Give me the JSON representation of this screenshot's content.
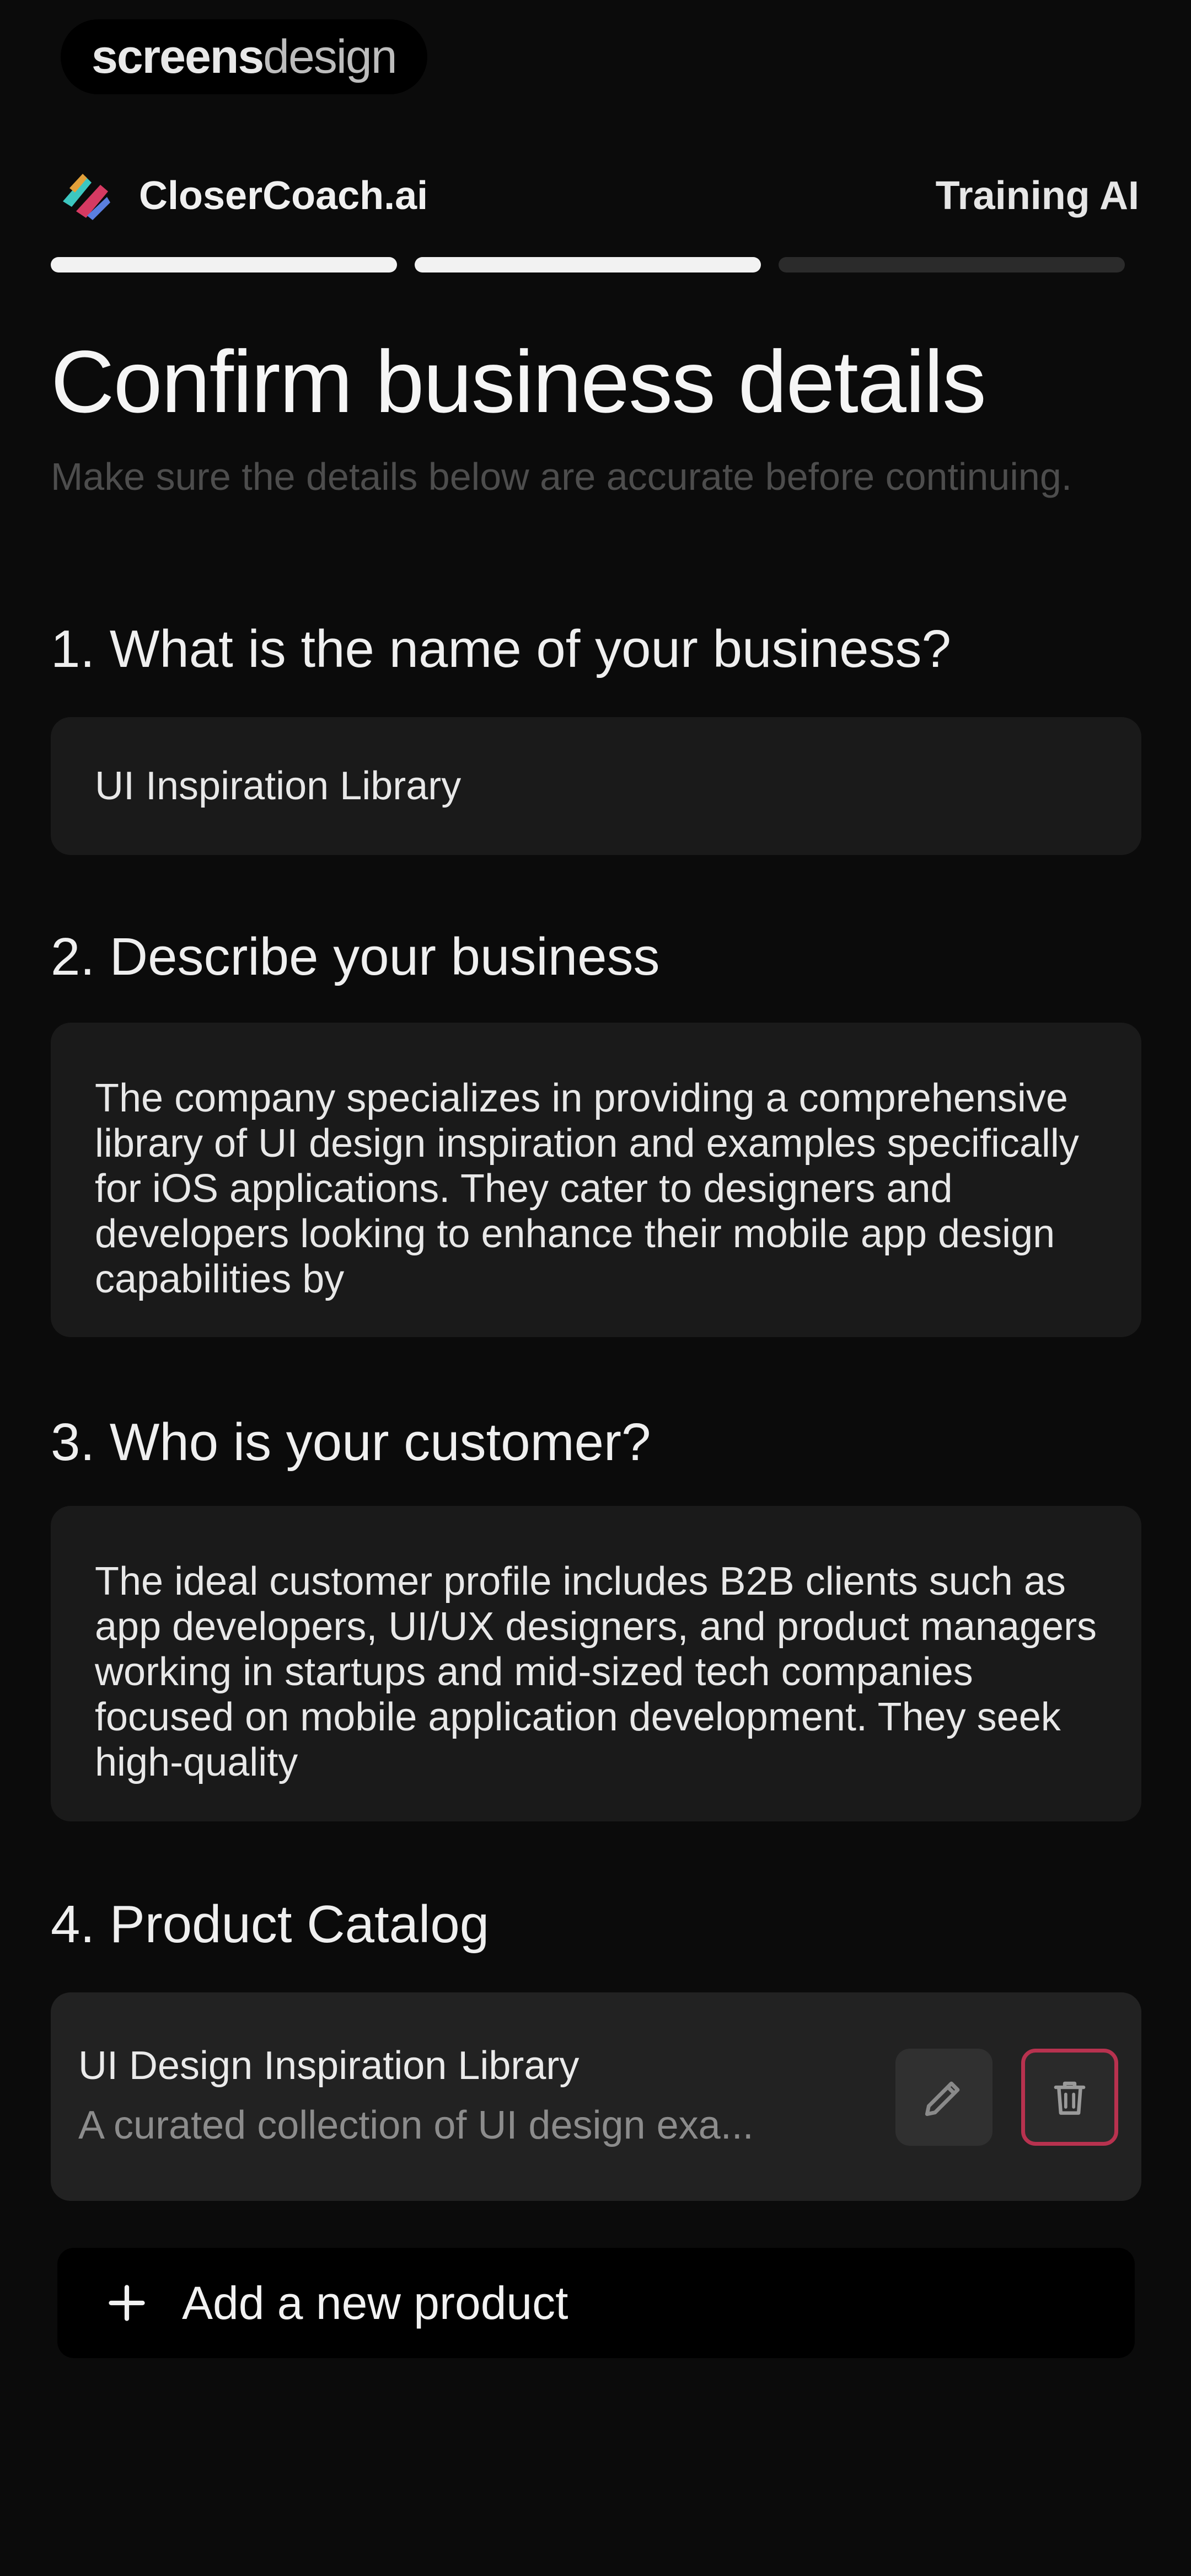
{
  "watermark": {
    "bold": "screens",
    "light": "design"
  },
  "header": {
    "brand": "CloserCoach.ai",
    "right_label": "Training AI",
    "progress": {
      "total_steps": 3,
      "completed_steps": 2
    }
  },
  "page": {
    "title": "Confirm business details",
    "subtitle": "Make sure the details below are accurate before continuing."
  },
  "questions": [
    {
      "label": "1. What is the name of your business?",
      "value": "UI Inspiration Library"
    },
    {
      "label": "2. Describe your business",
      "value": "The company specializes in providing a comprehensive library of UI design inspiration and examples specifically for iOS applications. They cater to designers and developers looking to enhance their mobile app design capabilities by"
    },
    {
      "label": "3. Who is your customer?",
      "value": "The ideal customer profile includes B2B clients such as app developers, UI/UX designers, and product managers working in startups and mid-sized tech companies focused on mobile application development. They seek high-quality"
    },
    {
      "label": "4. Product Catalog"
    }
  ],
  "products": [
    {
      "name": "UI Design Inspiration Library",
      "description": "A curated collection of UI design exa..."
    }
  ],
  "add_product": {
    "label": "Add a new product"
  },
  "colors": {
    "background": "#0b0b0b",
    "field": "#1a1a1a",
    "delete_accent": "#b8324f"
  },
  "icons": {
    "brand": "closercoach-logo-icon",
    "edit": "pencil-icon",
    "delete": "trash-icon",
    "add": "plus-icon"
  }
}
